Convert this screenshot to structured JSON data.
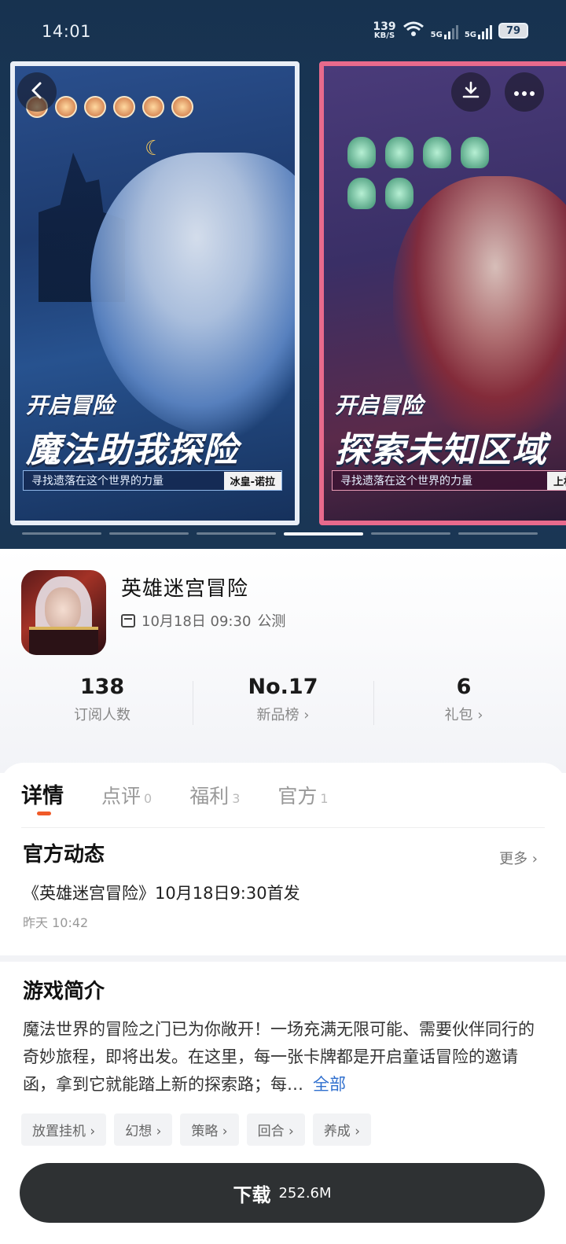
{
  "status_bar": {
    "time": "14:01",
    "net_speed_value": "139",
    "net_speed_unit": "KB/S",
    "signal1": "5G",
    "signal2": "5G",
    "battery": "79"
  },
  "gallery": {
    "shots": [
      {
        "slogan_small": "开启冒险",
        "slogan_big": "魔法助我探险",
        "subtitle": "寻找遗落在这个世界的力量",
        "tag": "冰皇-诺拉"
      },
      {
        "slogan_small": "开启冒险",
        "slogan_big": "探索未知区域",
        "subtitle": "寻找遗落在这个世界的力量",
        "tag": "上杉岚"
      }
    ],
    "page_count": 6,
    "active_page": 4
  },
  "app": {
    "name": "英雄迷宫冒险",
    "launch_date": "10月18日 09:30",
    "launch_type": "公测",
    "stats": [
      {
        "value": "138",
        "label": "订阅人数"
      },
      {
        "value": "No.17",
        "label": "新品榜 ›"
      },
      {
        "value": "6",
        "label": "礼包 ›"
      }
    ]
  },
  "tabs": [
    {
      "label": "详情",
      "count": ""
    },
    {
      "label": "点评",
      "count": "0"
    },
    {
      "label": "福利",
      "count": "3"
    },
    {
      "label": "官方",
      "count": "1"
    }
  ],
  "official": {
    "title": "官方动态",
    "more": "更多 ›",
    "post_title": "《英雄迷宫冒险》10月18日9:30首发",
    "post_time": "昨天 10:42"
  },
  "intro": {
    "title": "游戏简介",
    "text": "魔法世界的冒险之门已为你敞开！一场充满无限可能、需要伙伴同行的奇妙旅程，即将出发。在这里，每一张卡牌都是开启童话冒险的邀请函，拿到它就能踏上新的探索路；每…",
    "expand": "全部",
    "tags": [
      "放置挂机 ›",
      "幻想 ›",
      "策略 ›",
      "回合 ›",
      "养成 ›"
    ]
  },
  "download": {
    "label": "下载",
    "size": "252.6M"
  },
  "colors": {
    "accent": "#f05a28",
    "link": "#2f6fce",
    "button": "#2e3133",
    "hero_bg": "#1b3a5c"
  },
  "icons": [
    "back-icon",
    "download-icon",
    "more-icon",
    "calendar-icon",
    "wifi-icon",
    "battery-icon"
  ]
}
